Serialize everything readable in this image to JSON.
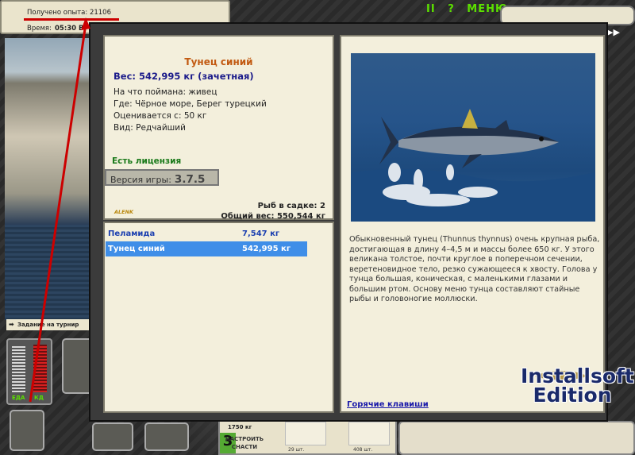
{
  "hud": {
    "experience_label": "Получено опыта: 21106",
    "time_label": "Время:",
    "time_value": "05:30 В",
    "menu": [
      "II",
      "?",
      "МЕНЮ"
    ],
    "skip": "▶▶",
    "task_label": "Задание на турнир",
    "gauge_left_label": "ЕДА",
    "gauge_right_label": "КД",
    "bottom_weight": "1750 кг",
    "bottom_setup": "НАСТРОИТЬ СНАСТИ",
    "bottom_count_1": "29 шт.",
    "bottom_count_2": "408 шт.",
    "bottom_tab": "3"
  },
  "fish_card": {
    "name": "Тунец синий",
    "weight": "Вес: 542,995 кг (зачетная)",
    "bait": "На что поймана: живец",
    "place": "Где: Чёрное море, Берег турецкий",
    "rated_from": "Оценивается с: 50 кг",
    "kind": "Вид: Редчайший",
    "license": "Есть лицензия",
    "version_label": "Версия игры:",
    "version_number": "3.7.5",
    "small_logo": "ALENK",
    "cage_count": "Рыб в садке: 2",
    "total_weight": "Общий вес: 550,544 кг"
  },
  "catch_list": [
    {
      "name": "Пеламида",
      "weight": "7,547 кг"
    },
    {
      "name": "Тунец синий",
      "weight": "542,995 кг"
    }
  ],
  "description": "Обыкновенный тунец (Thunnus thynnus) очень крупная рыба, достигающая в длину 4–4,5 м и массы более 650 кг. У этого великана толстое, почти круглое в поперечном сечении, веретеновидное тело, резко сужающееся к хвосту. Голова у тунца большая, коническая, с маленькими глазами и большим ртом. Основу меню тунца составляют стайные рыбы и головоногие моллюски.",
  "hotkeys_link": "Горячие клавиши",
  "watermark": {
    "line1": "Installsoft",
    "line2": "Edition"
  },
  "colors": {
    "accent_red": "#cc0000",
    "menu_green": "#5ce000",
    "selected_row": "#3f8ee8"
  }
}
